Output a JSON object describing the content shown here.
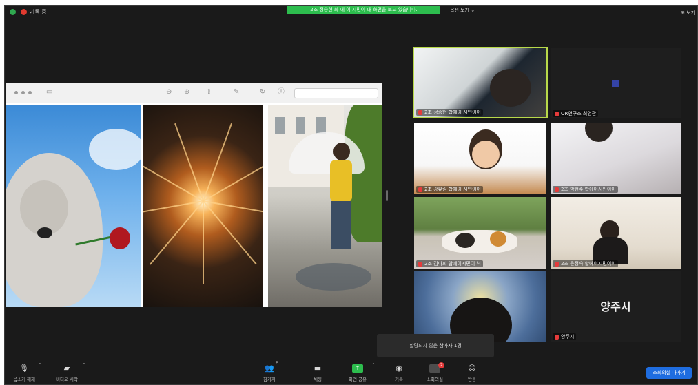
{
  "top_bar": {
    "recording_label": "기록 중",
    "banner_text": "2조 정승현 화 에 이 시민이 대 화면을 보고 있습니다.",
    "view_button": "옵션 보기 ⌄",
    "view_right": "⊞ 보기"
  },
  "gallery": [
    {
      "name": "2조 정승현 합에이 시민이이"
    },
    {
      "name": "OR연구소 최영관"
    },
    {
      "name": "2조 강유림 합에이 시민이이"
    },
    {
      "name": "2조 박현주 합에이시민이이"
    },
    {
      "name": "2조 김다희 합에이시민이 닉"
    },
    {
      "name": "2조 윤정숙 합에이시민이이"
    },
    {
      "name": ""
    },
    {
      "name": "양주시",
      "center_label": "양주시"
    }
  ],
  "toast": "할당되지 않은 참가자 1명",
  "toolbar": {
    "mute": "음소거 해제",
    "video": "비디오 시작",
    "participants": "참가자",
    "participants_count": "8",
    "chat": "채팅",
    "share": "화면 공유",
    "record": "기록",
    "breakout": "소회의실",
    "breakout_badge": "2",
    "reactions": "반응",
    "leave": "소회의실 나가기"
  },
  "colors": {
    "accent_green": "#2dbd4e",
    "leave_blue": "#1f6de0",
    "active_speaker_border": "#b8d94a"
  }
}
